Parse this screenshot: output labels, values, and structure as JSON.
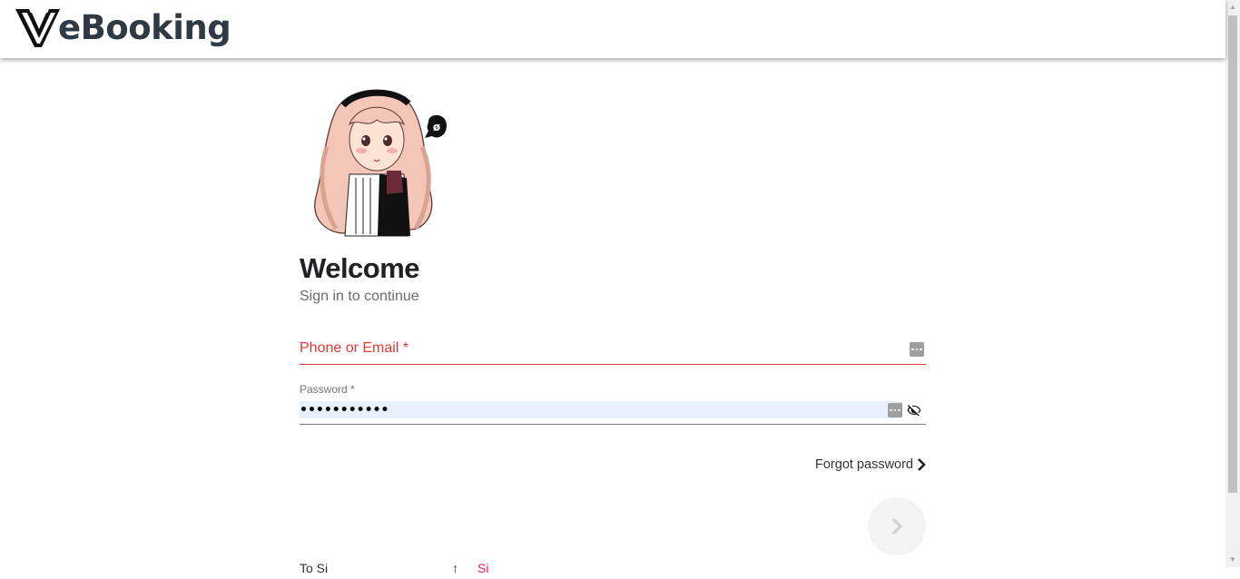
{
  "header": {
    "logo_text": "eBooking",
    "logo_icon": "v-letter-logo",
    "text_color": "#2f3a44"
  },
  "avatar": {
    "icon": "anime-girl-illustration",
    "speech_bubble_symbol": "ø"
  },
  "login": {
    "title": "Welcome",
    "subtitle": "Sign in to continue",
    "phone_field": {
      "label": "Phone or Email *",
      "value": "",
      "error_color": "#e53935"
    },
    "password_field": {
      "label": "Password *",
      "value": "•••••••••••",
      "autofill_bg": "#e8f0fe"
    },
    "forgot_password": "Forgot password",
    "submit_icon": "chevron-right-icon"
  },
  "footer_row": {
    "left_text": "To Si",
    "link_text": "Si",
    "link_color": "#e91e63"
  }
}
